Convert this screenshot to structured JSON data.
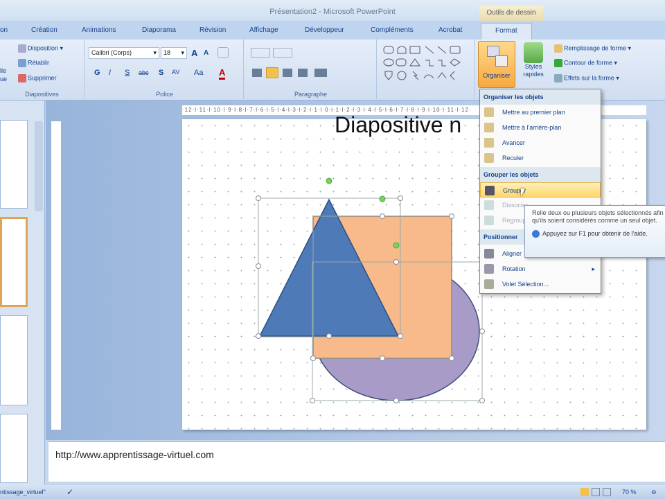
{
  "window": {
    "title": "Présentation2 - Microsoft PowerPoint",
    "context_tab": "Outils de dessin"
  },
  "tabs": [
    "on",
    "Création",
    "Animations",
    "Diaporama",
    "Révision",
    "Affichage",
    "Développeur",
    "Compléments",
    "Acrobat",
    "Format"
  ],
  "ribbon": {
    "diapositives": {
      "label": "Diapositives",
      "disposition": "Disposition",
      "retablir": "Rétablir",
      "supprimer": "Supprimer",
      "partial1": "lle",
      "partial2": "ue"
    },
    "police": {
      "label": "Police",
      "font": "Calibri (Corps)",
      "size": "18",
      "bold": "G",
      "italic": "I",
      "underline": "S",
      "strike": "abc",
      "shadow": "S",
      "spacing": "AV",
      "case": "Aa",
      "color": "A"
    },
    "paragraphe": {
      "label": "Paragraphe"
    },
    "organiser": "Organiser",
    "styles": "Styles rapides",
    "remplissage": "Remplissage de forme",
    "contour": "Contour de forme",
    "effets": "Effets sur la forme"
  },
  "ruler": "·12·l·11·l·10·l·9·l·8·l·7·l·6·l·5·l·4·l·3·l·2·l·1·l·0·l·1·l·2·l·3·l·4·l·5·l·6·l·7·l·8·l·9·l·10·l·11·l·12·",
  "slide": {
    "title": "Diapositive n"
  },
  "colors": {
    "triangle": "#4f7ab8",
    "square": "#f8b98b",
    "ellipse": "#a99bc8"
  },
  "menu": {
    "h1": "Organiser les objets",
    "items1": [
      "Mettre au premier plan",
      "Mettre à l'arrière-plan",
      "Avancer",
      "Reculer"
    ],
    "h2": "Grouper les objets",
    "items2": [
      "Grouper",
      "Dissocier",
      "Regrouper"
    ],
    "h3": "Positionner",
    "items3": [
      "Aligner",
      "Rotation",
      "Volet Sélection..."
    ]
  },
  "tooltip": {
    "text": "Relie deux ou plusieurs objets sélectionnés afin qu'ils soient considérés comme un seul objet.",
    "help": "Appuyez sur F1 pour obtenir de l'aide."
  },
  "notes": "http://www.apprentissage-virtuel.com",
  "status": {
    "left": "ntissage_virtuel\"",
    "zoom": "70 %"
  }
}
